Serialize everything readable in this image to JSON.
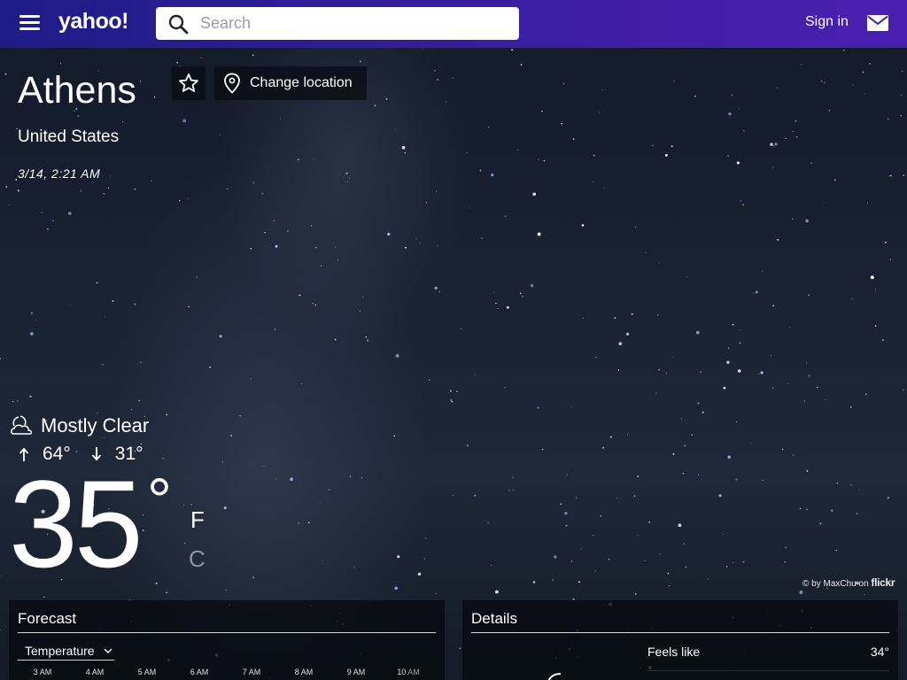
{
  "header": {
    "logo": "yahoo!",
    "search_placeholder": "Search",
    "signin_label": "Sign in"
  },
  "location": {
    "city": "Athens",
    "country": "United States",
    "datetime": "3/14, 2:21 AM",
    "change_location_label": "Change location"
  },
  "conditions": {
    "summary": "Mostly Clear",
    "high": "64°",
    "low": "31°",
    "temperature": "35",
    "degree_symbol": "°",
    "unit_f": "F",
    "unit_c": "C",
    "selected_unit": "F"
  },
  "photo_credit": {
    "prefix": "© by MaxChu on",
    "source": "flickr"
  },
  "forecast": {
    "title": "Forecast",
    "dropdown_label": "Temperature",
    "hours": [
      "3 AM",
      "4 AM",
      "5 AM",
      "6 AM",
      "7 AM",
      "8 AM",
      "9 AM",
      "10 AM"
    ]
  },
  "details": {
    "title": "Details",
    "rows": [
      {
        "label": "Feels like",
        "value": "34°"
      }
    ]
  },
  "colors": {
    "header_start": "#1d1c86",
    "header_end": "#4a1fb0",
    "unselected_unit": "#8c93a0"
  },
  "icons": {
    "menu": "hamburger-icon",
    "search": "search-icon",
    "mail": "mail-icon",
    "favorite": "star-outline-icon",
    "location": "map-pin-icon",
    "condition": "moon-cloud-icon",
    "high": "arrow-up-icon",
    "low": "arrow-down-icon",
    "dropdown": "chevron-down-icon"
  }
}
